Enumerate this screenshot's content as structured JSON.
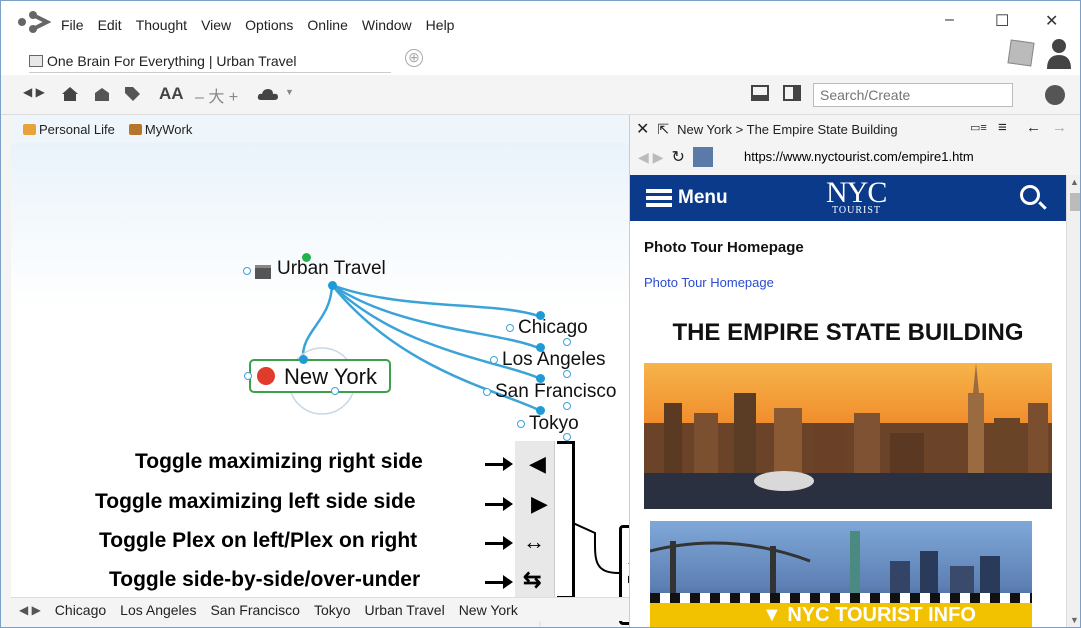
{
  "menu": [
    "File",
    "Edit",
    "Thought",
    "View",
    "Options",
    "Online",
    "Window",
    "Help"
  ],
  "window_controls": {
    "minimize": "–",
    "maximize": "☐",
    "close": "✕"
  },
  "tab": {
    "title": "One Brain For Everything | Urban Travel",
    "add": "⊕"
  },
  "toolbar": {
    "icons": [
      "back-forward-icon",
      "home-icon",
      "brain-icon",
      "tag-icon",
      "font-size-icon",
      "layout-icon",
      "cloud-icon"
    ],
    "font_label": "AA",
    "search_placeholder": "Search/Create"
  },
  "pins": [
    {
      "label": "Personal Life",
      "color": "#e8a23a"
    },
    {
      "label": "MyWork",
      "color": "#b5752a"
    }
  ],
  "graph": {
    "parent": "Urban Travel",
    "active": "New York",
    "children": [
      "Chicago",
      "Los Angeles",
      "San Francisco",
      "Tokyo"
    ],
    "link_color": "#3ba3d8",
    "active_border": "#3aa14a"
  },
  "callouts": {
    "max_right": "Toggle maximizing right side",
    "max_left": "Toggle maximizing left side side",
    "plex": "Toggle Plex on left/Plex on right",
    "layout": "Toggle side-by-side/over-under"
  },
  "strip_icons": {
    "left": "◀",
    "right": "▶",
    "swap": "↔",
    "cycle": "⇆"
  },
  "bottombar": {
    "items": [
      "Chicago",
      "Los Angeles",
      "San Francisco",
      "Tokyo",
      "Urban Travel",
      "New York"
    ]
  },
  "browser": {
    "breadcrumb": "New York > The Empire State Building",
    "url": "https://www.nyctourist.com/empire1.htm"
  },
  "website": {
    "menu_label": "Menu",
    "logo_main": "NYC",
    "logo_sub": "TOURIST",
    "page_title": "Photo Tour Homepage",
    "link": "Photo Tour Homepage",
    "heading": "THE EMPIRE STATE BUILDING",
    "banner": "▼ NYC TOURIST INFO",
    "brand_color": "#0b3a8a"
  }
}
